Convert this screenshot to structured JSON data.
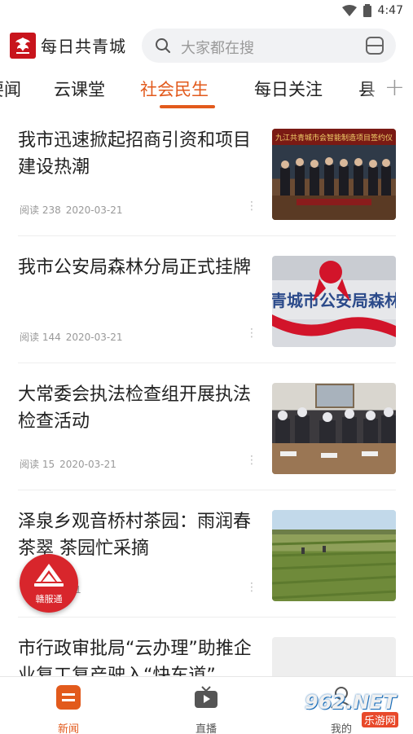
{
  "status_bar": {
    "time": "4:47"
  },
  "header": {
    "app_title": "每日共青城",
    "search_placeholder": "大家都在搜"
  },
  "tabs": [
    {
      "label": "要闻"
    },
    {
      "label": "云课堂"
    },
    {
      "label": "社会民生",
      "active": true
    },
    {
      "label": "每日关注"
    },
    {
      "label": "县"
    }
  ],
  "news": [
    {
      "title": "我市迅速掀起招商引资和项目建设热潮",
      "reads_label": "阅读 238",
      "date": "2020-03-21",
      "thumb_text": "九江共青城市会智能制造项目签约仪"
    },
    {
      "title": "我市公安局森林分局正式挂牌",
      "reads_label": "阅读 144",
      "date": "2020-03-21",
      "thumb_text": "青城市公安局森林"
    },
    {
      "title": "大常委会执法检查组开展执法检查活动",
      "reads_label": "阅读 15",
      "date": "2020-03-21"
    },
    {
      "title": "泽泉乡观音桥村茶园：雨润春茶翠 茶园忙采摘",
      "reads_label": "",
      "date": "2020-03-21"
    },
    {
      "title": "市行政审批局“云办理”助推企业复工复产驶入“快车道”",
      "reads_label": "",
      "date": ""
    }
  ],
  "fab": {
    "label": "赣服通"
  },
  "bottom_nav": [
    {
      "label": "新闻",
      "active": true
    },
    {
      "label": "直播"
    },
    {
      "label": "我的"
    }
  ],
  "watermark": {
    "main": "962.NET",
    "sub": "乐游网"
  },
  "colors": {
    "accent": "#e25a1c",
    "brand_red": "#c8141c",
    "fab_red": "#d8262c"
  }
}
